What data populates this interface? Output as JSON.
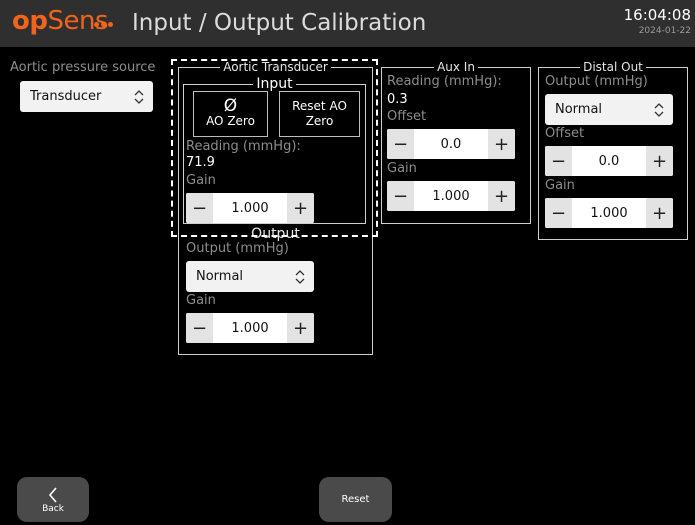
{
  "header": {
    "logo_op": "op",
    "logo_sens": "Sens",
    "title": "Input / Output Calibration",
    "time": "16:04:08",
    "date": "2024-01-22",
    "accent_color": "#f0641e"
  },
  "aortic_source": {
    "label": "Aortic pressure source",
    "selected": "Transducer"
  },
  "aortic_transducer": {
    "title": "Aortic Transducer",
    "input": {
      "title": "Input",
      "ao_zero_icon": "Ø",
      "ao_zero_label": "AO Zero",
      "reset_ao_zero_label": "Reset AO Zero",
      "reading_label": "Reading (mmHg):",
      "reading_value": "71.9",
      "gain_label": "Gain",
      "gain_value": "1.000"
    },
    "output": {
      "title": "Output",
      "output_label": "Output (mmHg)",
      "output_selected": "Normal",
      "gain_label": "Gain",
      "gain_value": "1.000"
    }
  },
  "aux_in": {
    "title": "Aux In",
    "reading_label": "Reading (mmHg):",
    "reading_value": "0.3",
    "offset_label": "Offset",
    "offset_value": "0.0",
    "gain_label": "Gain",
    "gain_value": "1.000"
  },
  "distal_out": {
    "title": "Distal Out",
    "output_label": "Output (mmHg)",
    "output_selected": "Normal",
    "offset_label": "Offset",
    "offset_value": "0.0",
    "gain_label": "Gain",
    "gain_value": "1.000"
  },
  "footer": {
    "back_label": "Back",
    "back_icon": "chevron-left-icon",
    "reset_label": "Reset"
  },
  "stepper": {
    "minus": "−",
    "plus": "+"
  }
}
